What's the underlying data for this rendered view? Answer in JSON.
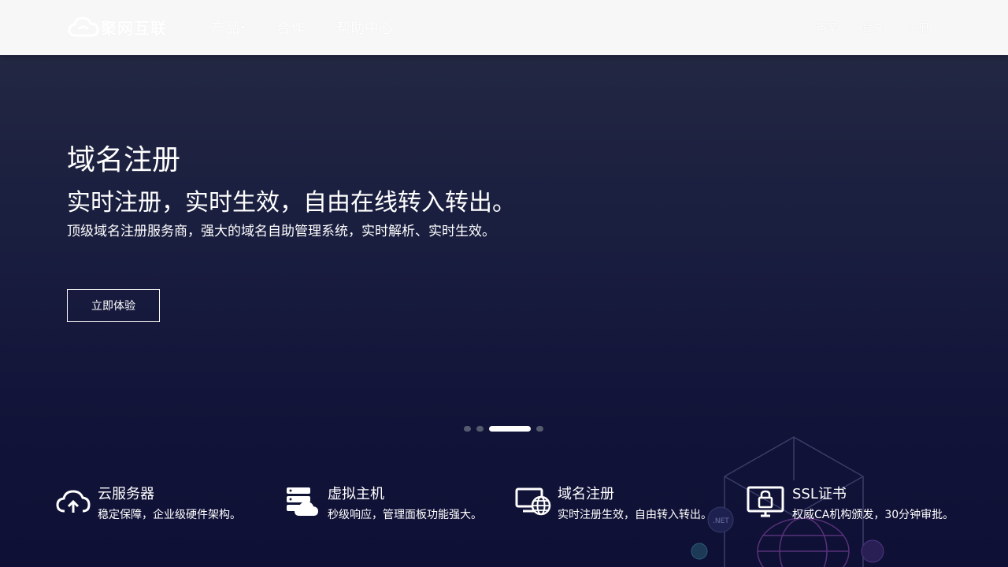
{
  "header": {
    "logo_text": "聚网互联",
    "nav": [
      {
        "label": "产品",
        "has_caret": true
      },
      {
        "label": "合作"
      },
      {
        "label": "帮助中心"
      }
    ],
    "right": [
      "备案",
      "登录",
      "注册"
    ]
  },
  "hero": {
    "title": "域名注册",
    "subtitle": "实时注册，实时生效，自由在线转入转出。",
    "description": "顶级域名注册服务商，强大的域名自助管理系统，实时解析、实时生效。",
    "button_label": "立即体验"
  },
  "carousel": {
    "total": 4,
    "active_index": 2
  },
  "decor_text": ".NET",
  "features": [
    {
      "title": "云服务器",
      "desc": "稳定保障，企业级硬件架构。",
      "icon": "cloud-upload-icon"
    },
    {
      "title": "虚拟主机",
      "desc": "秒级响应，管理面板功能强大。",
      "icon": "server-cloud-icon"
    },
    {
      "title": "域名注册",
      "desc": "实时注册生效，自由转入转出。",
      "icon": "globe-monitor-icon"
    },
    {
      "title": "SSL证书",
      "desc": "权威CA机构颁发，30分钟审批。",
      "icon": "lock-monitor-icon"
    }
  ],
  "colors": {
    "header_bg": "#f7f7f7",
    "background_top": "#252a43",
    "background_bottom": "#0f1035",
    "dot_inactive": "#555b6e",
    "dot_active": "#ffffff"
  }
}
